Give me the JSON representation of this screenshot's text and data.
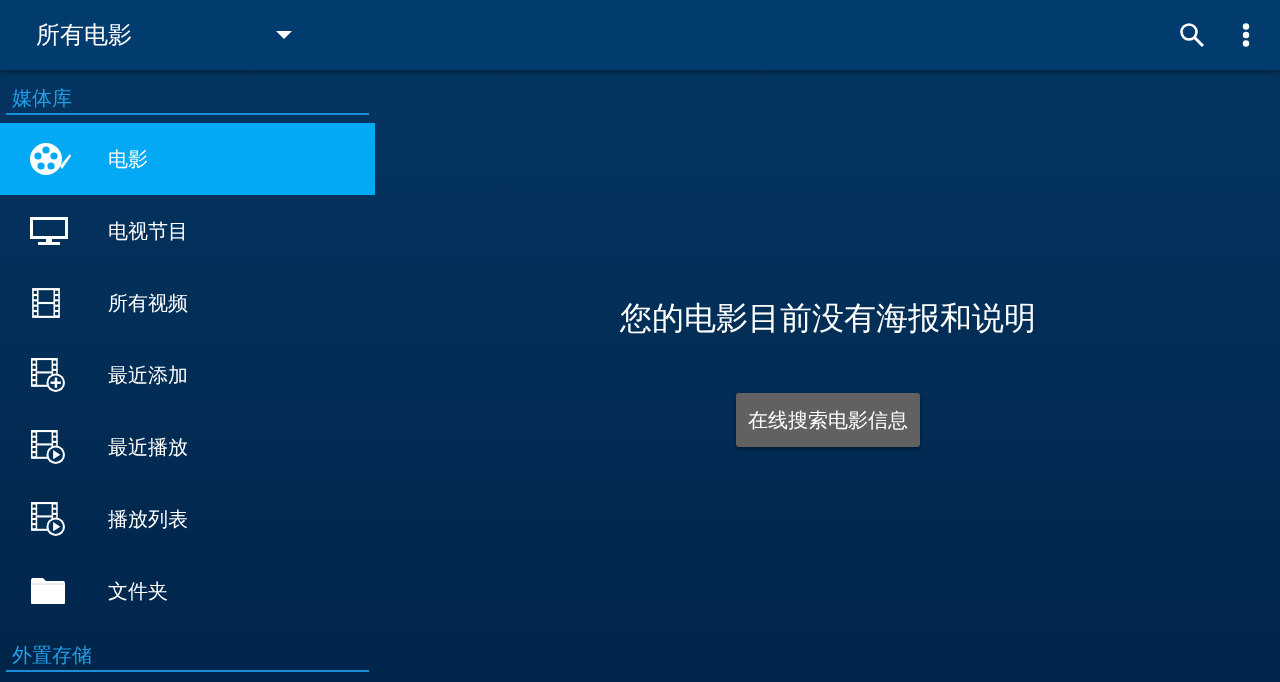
{
  "app_bar": {
    "title": "所有电影"
  },
  "sidebar": {
    "sections": [
      {
        "header": "媒体库",
        "items": [
          {
            "label": "电影",
            "kind": "reel",
            "selected": true
          },
          {
            "label": "电视节目",
            "kind": "tv",
            "selected": false
          },
          {
            "label": "所有视频",
            "kind": "film",
            "selected": false
          },
          {
            "label": "最近添加",
            "kind": "filmplus",
            "selected": false
          },
          {
            "label": "最近播放",
            "kind": "filmplay",
            "selected": false
          },
          {
            "label": "播放列表",
            "kind": "filmplay",
            "selected": false
          },
          {
            "label": "文件夹",
            "kind": "folder",
            "selected": false
          }
        ]
      },
      {
        "header": "外置存储"
      }
    ]
  },
  "main": {
    "message": "您的电影目前没有海报和说明",
    "button": "在线搜索电影信息"
  }
}
